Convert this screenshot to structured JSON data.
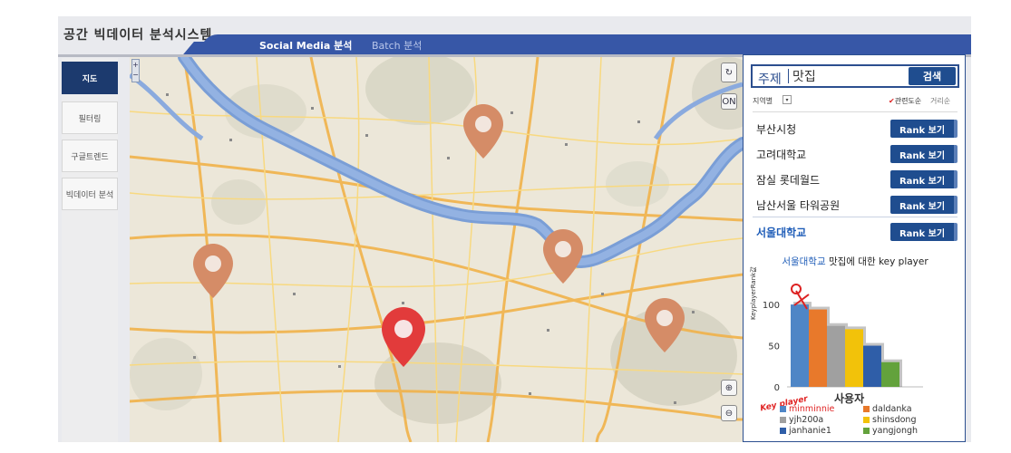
{
  "header": {
    "app_title": "공간 빅데이터 분석시스템",
    "tabs": [
      {
        "label": "Social Media 분석",
        "active": true
      },
      {
        "label": "Batch 분석",
        "active": false
      }
    ]
  },
  "left_menu": [
    {
      "label": "지도",
      "active": true
    },
    {
      "label": "필터링",
      "active": false
    },
    {
      "label": "구글트렌드",
      "active": false
    },
    {
      "label": "빅데이터 분석",
      "active": false
    }
  ],
  "map": {
    "zoom_in_icon": "zoom-in-icon",
    "zoom_out_icon": "zoom-out-icon",
    "refresh_label": "초기화",
    "on_label": "ON",
    "pin_colors": {
      "normal": "#d58c67",
      "selected": "#e23b3b"
    }
  },
  "panel": {
    "topic_label": "주제",
    "search_value": "맛집",
    "search_button": "검색",
    "region_label": "지역별",
    "region_dropdown_icon": "chevron-down-icon",
    "sort_relevance": "관련도순",
    "sort_distance": "거리순",
    "locations": [
      {
        "name": "부산시청",
        "button": "Rank 보기",
        "selected": false
      },
      {
        "name": "고려대학교",
        "button": "Rank 보기",
        "selected": false
      },
      {
        "name": "잠실 롯데월드",
        "button": "Rank 보기",
        "selected": false
      },
      {
        "name": "남산서울 타워공원",
        "button": "Rank 보기",
        "selected": false
      },
      {
        "name": "서울대학교",
        "button": "Rank 보기",
        "selected": true
      }
    ],
    "key_player": {
      "title_highlight": "서울대학교",
      "title_rest": " 맛집에 대한 key player",
      "badge": "Key player"
    }
  },
  "chart_data": {
    "type": "bar",
    "title": "서울대학교 맛집에 대한 key player",
    "xlabel": "사용자",
    "ylabel": "KeyplayerRank값",
    "ylim": [
      0,
      110
    ],
    "yticks": [
      0,
      50,
      100
    ],
    "categories": [
      "minminnie",
      "daldanka",
      "yjh200a",
      "shinsdong",
      "janhanie1",
      "yangjongh"
    ],
    "values": [
      100,
      94,
      74,
      70,
      50,
      30
    ],
    "colors": [
      "#4f86c6",
      "#e8792b",
      "#a0a0a0",
      "#f2c20a",
      "#2f5ea8",
      "#63a23c"
    ],
    "highlighted": "minminnie",
    "legend_placement": "bottom"
  }
}
